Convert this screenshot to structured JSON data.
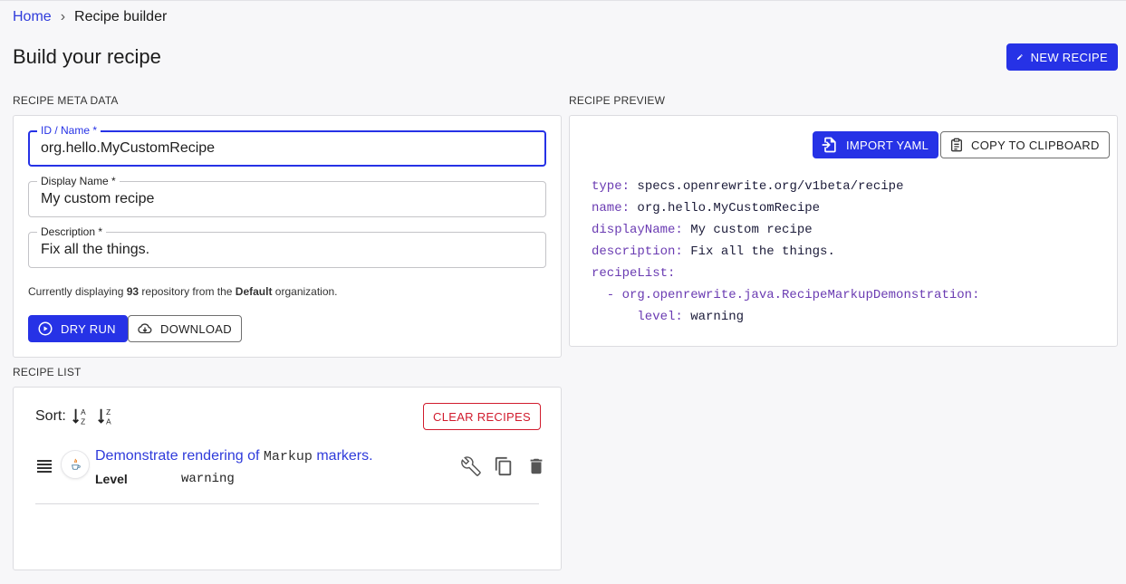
{
  "breadcrumb": {
    "home": "Home",
    "separator": "›",
    "current": "Recipe builder"
  },
  "page": {
    "title": "Build your recipe",
    "new_recipe_label": "NEW RECIPE"
  },
  "meta": {
    "section_label": "RECIPE META DATA",
    "id_label": "ID / Name *",
    "id_value": "org.hello.MyCustomRecipe",
    "display_label": "Display Name *",
    "display_value": "My custom recipe",
    "desc_label": "Description *",
    "desc_value": "Fix all the things.",
    "note_prefix": "Currently displaying ",
    "note_count": "93",
    "note_middle": " repository from the ",
    "note_org": "Default",
    "note_suffix": " organization.",
    "dry_run_label": "DRY RUN",
    "download_label": "DOWNLOAD"
  },
  "preview": {
    "section_label": "RECIPE PREVIEW",
    "import_label": "IMPORT YAML",
    "copy_label": "COPY TO CLIPBOARD",
    "yaml": {
      "l1k": "type:",
      "l1v": " specs.openrewrite.org/v1beta/recipe",
      "l2k": "name:",
      "l2v": " org.hello.MyCustomRecipe",
      "l3k": "displayName:",
      "l3v": " My custom recipe",
      "l4k": "description:",
      "l4v": " Fix all the things.",
      "l5k": "recipeList:",
      "l6k": "  - org.openrewrite.java.RecipeMarkupDemonstration:",
      "l7k": "      level:",
      "l7v": " warning"
    }
  },
  "list": {
    "section_label": "RECIPE LIST",
    "sort_label": "Sort:",
    "clear_label": "CLEAR RECIPES",
    "items": [
      {
        "title_prefix": "Demonstrate rendering of ",
        "title_mono": "Markup",
        "title_suffix": " markers.",
        "option_name": "Level",
        "option_value": "warning"
      }
    ]
  },
  "colors": {
    "primary": "#2632e6",
    "link": "#2f3bdb",
    "danger": "#d11b2d",
    "yaml_key": "#6a3bb2"
  },
  "icons": [
    "pencil-icon",
    "play-circle-icon",
    "cloud-download-icon",
    "file-import-icon",
    "clipboard-icon",
    "sort-alpha-asc-icon",
    "sort-alpha-desc-icon",
    "drag-handle-icon",
    "java-logo-icon",
    "wrench-icon",
    "copy-icon",
    "trash-icon"
  ]
}
